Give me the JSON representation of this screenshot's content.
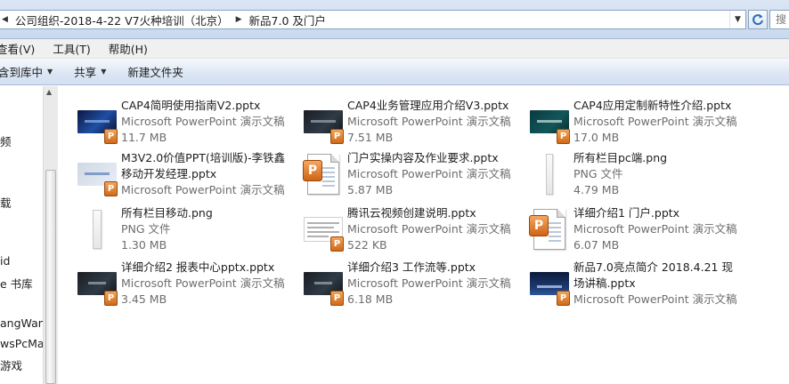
{
  "address": {
    "crumbs": [
      "公司组织-2018-4-22 V7火种培训（北京）",
      "新品7.0 及门户"
    ],
    "search_placeholder": "搜"
  },
  "menu": [
    "查看(V)",
    "工具(T)",
    "帮助(H)"
  ],
  "toolbar": {
    "include_library": "含到库中",
    "share": "共享",
    "new_folder": "新建文件夹"
  },
  "sidebar": {
    "items": [
      "频",
      "载",
      "id",
      "e 书库",
      "angWan",
      "wsPcMa",
      "游戏"
    ]
  },
  "files": [
    {
      "name": "CAP4简明使用指南V2.pptx",
      "type": "Microsoft PowerPoint 演示文稿",
      "size": "11.7 MB",
      "icon": "ppt-slide-blue-icon"
    },
    {
      "name": "CAP4业务管理应用介绍V3.pptx",
      "type": "Microsoft PowerPoint 演示文稿",
      "size": "7.51 MB",
      "icon": "ppt-slide-dark-icon"
    },
    {
      "name": "CAP4应用定制新特性介绍.pptx",
      "type": "Microsoft PowerPoint 演示文稿",
      "size": "17.0 MB",
      "icon": "ppt-slide-teal-icon"
    },
    {
      "name": "M3V2.0价值PPT(培训版)-李铁鑫移动开发经理.pptx",
      "type": "Microsoft PowerPoint 演示文稿",
      "size": "",
      "icon": "ppt-slide-grey-icon"
    },
    {
      "name": "门户实操内容及作业要求.pptx",
      "type": "Microsoft PowerPoint 演示文稿",
      "size": "5.87 MB",
      "icon": "ppt-document-icon"
    },
    {
      "name": "所有栏目pc端.png",
      "type": "PNG 文件",
      "size": "4.79 MB",
      "icon": "png-image-icon"
    },
    {
      "name": "所有栏目移动.png",
      "type": "PNG 文件",
      "size": "1.30 MB",
      "icon": "png-image-icon"
    },
    {
      "name": "腾讯云视频创建说明.pptx",
      "type": "Microsoft PowerPoint 演示文稿",
      "size": "522 KB",
      "icon": "ppt-slide-sheet-icon"
    },
    {
      "name": "详细介绍1 门户.pptx",
      "type": "Microsoft PowerPoint 演示文稿",
      "size": "6.07 MB",
      "icon": "ppt-document-icon"
    },
    {
      "name": "详细介绍2 报表中心pptx.pptx",
      "type": "Microsoft PowerPoint 演示文稿",
      "size": "3.45 MB",
      "icon": "ppt-slide-dark-icon"
    },
    {
      "name": "详细介绍3 工作流等.pptx",
      "type": "Microsoft PowerPoint 演示文稿",
      "size": "6.18 MB",
      "icon": "ppt-slide-dark-icon"
    },
    {
      "name": "新品7.0亮点简介 2018.4.21 现场讲稿.pptx",
      "type": "Microsoft PowerPoint 演示文稿",
      "size": "",
      "icon": "ppt-slide-night-icon"
    }
  ],
  "colors": {
    "accent": "#dbe6f4",
    "ppt_orange": "#d06a1a",
    "secondary_text": "#6d6d6d"
  }
}
